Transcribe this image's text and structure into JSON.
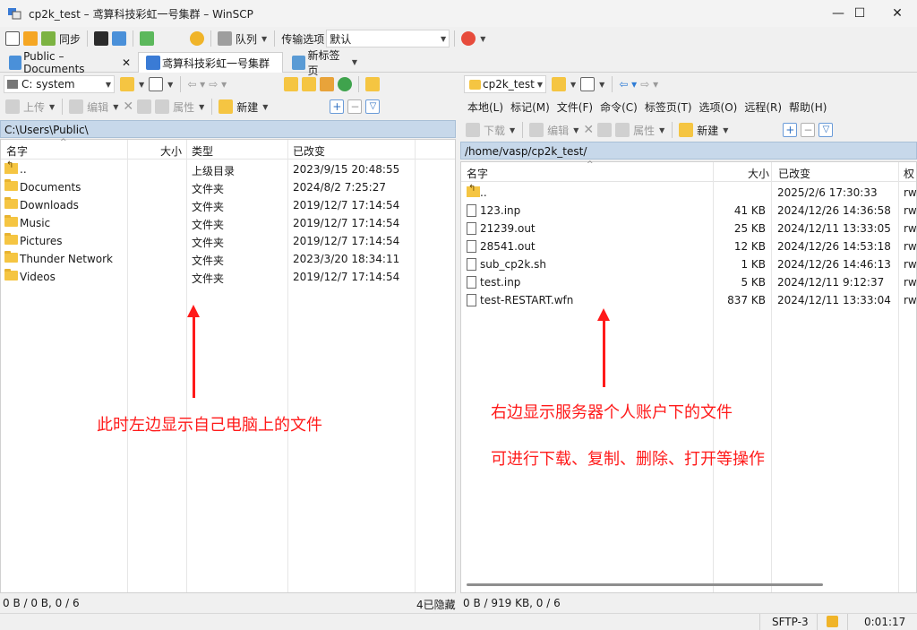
{
  "window": {
    "title": "cp2k_test – 鸢算科技彩虹一号集群 – WinSCP",
    "minimize": "—",
    "maximize": "☐",
    "close": "✕"
  },
  "toolbar": {
    "sync_label": "同步",
    "queue_label": "队列",
    "transfer_options_label": "传输选项",
    "transfer_preset": "默认"
  },
  "tabs": [
    {
      "label": "Public – Documents"
    },
    {
      "label": "鸢算科技彩虹一号集群"
    },
    {
      "label": "新标签页"
    }
  ],
  "left": {
    "drive": "C: system",
    "upload_label": "上传",
    "edit_label": "编辑",
    "properties_label": "属性",
    "new_label": "新建",
    "path": "C:\\Users\\Public\\",
    "columns": {
      "name": "名字",
      "size": "大小",
      "type": "类型",
      "modified": "已改变"
    },
    "rows": [
      {
        "name": "..",
        "type": "上级目录",
        "modified": "2023/9/15 20:48:55",
        "icon": "parent-dir"
      },
      {
        "name": "Documents",
        "type": "文件夹",
        "modified": "2024/8/2 7:25:27",
        "icon": "folder"
      },
      {
        "name": "Downloads",
        "type": "文件夹",
        "modified": "2019/12/7 17:14:54",
        "icon": "folder"
      },
      {
        "name": "Music",
        "type": "文件夹",
        "modified": "2019/12/7 17:14:54",
        "icon": "folder"
      },
      {
        "name": "Pictures",
        "type": "文件夹",
        "modified": "2019/12/7 17:14:54",
        "icon": "folder"
      },
      {
        "name": "Thunder Network",
        "type": "文件夹",
        "modified": "2023/3/20 18:34:11",
        "icon": "folder"
      },
      {
        "name": "Videos",
        "type": "文件夹",
        "modified": "2019/12/7 17:14:54",
        "icon": "folder"
      }
    ],
    "status": "0 B / 0 B,  0 / 6",
    "hidden": "4已隐藏"
  },
  "right": {
    "session": "cp2k_test",
    "menu": [
      "本地(L)",
      "标记(M)",
      "文件(F)",
      "命令(C)",
      "标签页(T)",
      "选项(O)",
      "远程(R)",
      "帮助(H)"
    ],
    "download_label": "下载",
    "edit_label": "编辑",
    "properties_label": "属性",
    "new_label": "新建",
    "path": "/home/vasp/cp2k_test/",
    "columns": {
      "name": "名字",
      "size": "大小",
      "modified": "已改变",
      "rights": "权"
    },
    "rows": [
      {
        "name": "..",
        "size": "",
        "modified": "2025/2/6 17:30:33",
        "rights": "rw",
        "icon": "parent-dir"
      },
      {
        "name": "123.inp",
        "size": "41 KB",
        "modified": "2024/12/26 14:36:58",
        "rights": "rw",
        "icon": "file"
      },
      {
        "name": "21239.out",
        "size": "25 KB",
        "modified": "2024/12/11 13:33:05",
        "rights": "rw",
        "icon": "file"
      },
      {
        "name": "28541.out",
        "size": "12 KB",
        "modified": "2024/12/26 14:53:18",
        "rights": "rw",
        "icon": "file"
      },
      {
        "name": "sub_cp2k.sh",
        "size": "1 KB",
        "modified": "2024/12/26 14:46:13",
        "rights": "rw",
        "icon": "file"
      },
      {
        "name": "test.inp",
        "size": "5 KB",
        "modified": "2024/12/11 9:12:37",
        "rights": "rw",
        "icon": "file"
      },
      {
        "name": "test-RESTART.wfn",
        "size": "837 KB",
        "modified": "2024/12/11 13:33:04",
        "rights": "rw",
        "icon": "file"
      }
    ],
    "status": "0 B / 919 KB,  0 / 6"
  },
  "annotations": {
    "left_note": "此时左边显示自己电脑上的文件",
    "right_note_1": "右边显示服务器个人账户下的文件",
    "right_note_2": "可进行下载、复制、删除、打开等操作",
    "color": "#ff1a1a"
  },
  "statusbar": {
    "protocol": "SFTP-3",
    "elapsed": "0:01:17"
  }
}
